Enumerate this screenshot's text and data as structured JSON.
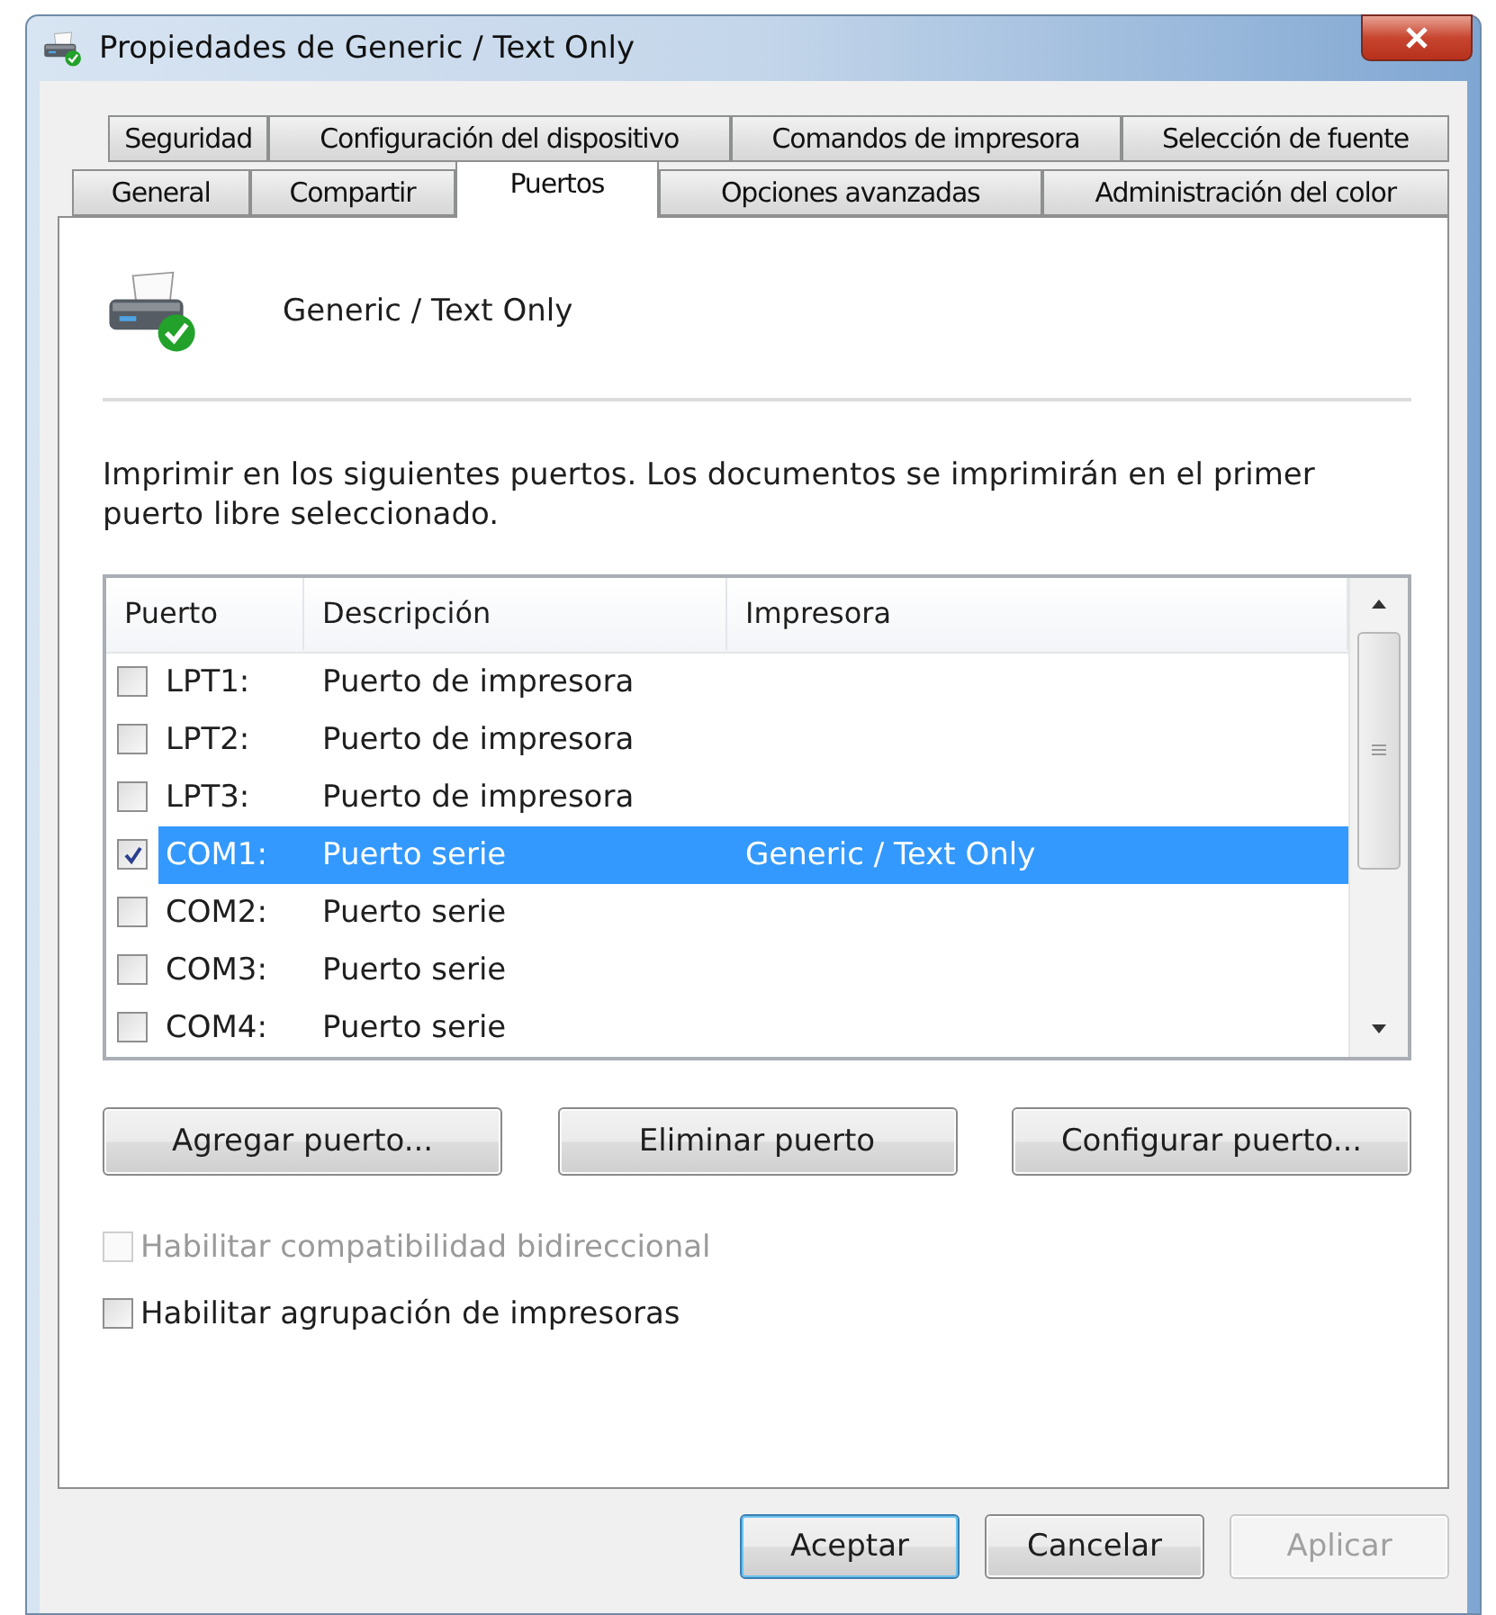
{
  "window": {
    "title": "Propiedades de Generic / Text Only"
  },
  "tab_rows": [
    [
      {
        "label": "Seguridad",
        "selected": false
      },
      {
        "label": "Configuración del dispositivo",
        "selected": false
      },
      {
        "label": "Comandos de impresora",
        "selected": false
      },
      {
        "label": "Selección de fuente",
        "selected": false
      }
    ],
    [
      {
        "label": "General",
        "selected": false
      },
      {
        "label": "Compartir",
        "selected": false
      },
      {
        "label": "Puertos",
        "selected": true
      },
      {
        "label": "Opciones avanzadas",
        "selected": false
      },
      {
        "label": "Administración del color",
        "selected": false
      }
    ]
  ],
  "printer_name": "Generic / Text Only",
  "instructions": "Imprimir en los siguientes puertos. Los documentos se imprimirán en el primer puerto libre seleccionado.",
  "ports_table": {
    "columns": [
      "Puerto",
      "Descripción",
      "Impresora"
    ],
    "rows": [
      {
        "port": "LPT1:",
        "description": "Puerto de impresora",
        "checked": false,
        "selected": false
      },
      {
        "port": "LPT2:",
        "description": "Puerto de impresora",
        "checked": false,
        "selected": false
      },
      {
        "port": "LPT3:",
        "description": "Puerto de impresora",
        "checked": false,
        "selected": false
      },
      {
        "port": "COM1:",
        "description": "Puerto serie",
        "printer": "Generic / Text Only",
        "checked": true,
        "selected": true
      },
      {
        "port": "COM2:",
        "description": "Puerto serie",
        "checked": false,
        "selected": false
      },
      {
        "port": "COM3:",
        "description": "Puerto serie",
        "checked": false,
        "selected": false
      },
      {
        "port": "COM4:",
        "description": "Puerto serie",
        "checked": false,
        "selected": false
      }
    ]
  },
  "port_buttons": [
    "Agregar puerto...",
    "Eliminar puerto",
    "Configurar puerto..."
  ],
  "options": [
    {
      "label": "Habilitar compatibilidad bidireccional",
      "checked": false,
      "disabled": true
    },
    {
      "label": "Habilitar agrupación de impresoras",
      "checked": false,
      "disabled": false
    }
  ],
  "dialog_buttons": [
    {
      "label": "Aceptar",
      "default": true,
      "disabled": false
    },
    {
      "label": "Cancelar",
      "default": false,
      "disabled": false
    },
    {
      "label": "Aplicar",
      "default": false,
      "disabled": true
    }
  ]
}
